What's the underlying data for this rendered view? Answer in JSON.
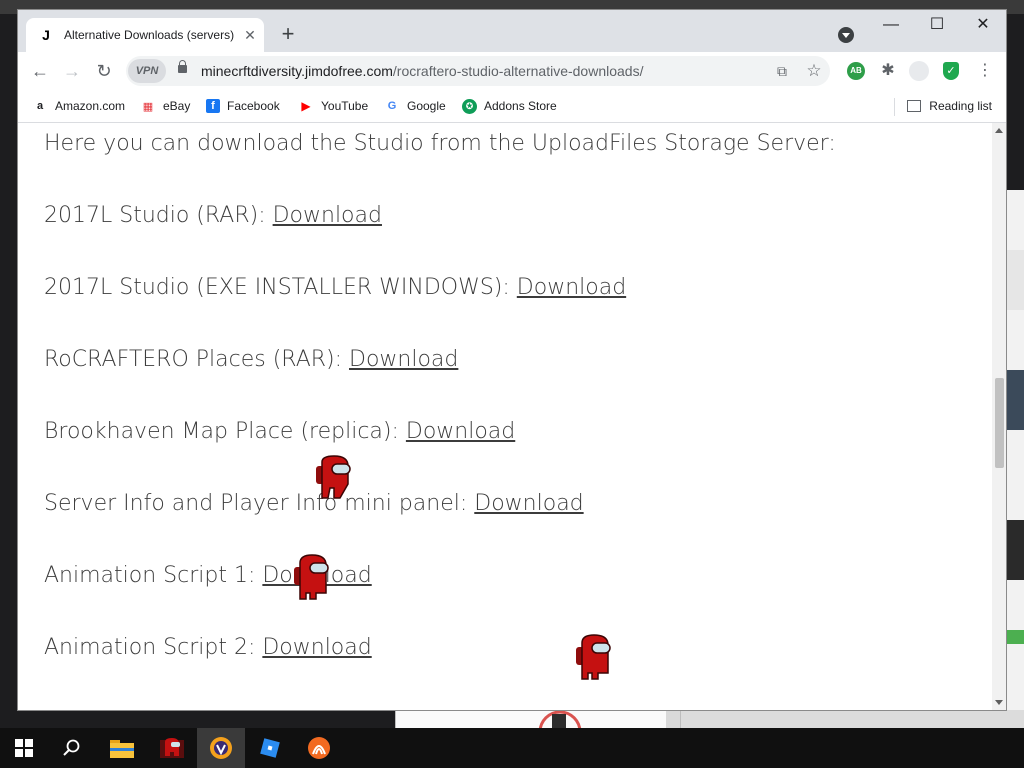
{
  "tab": {
    "favicon": "J",
    "title": "Alternative Downloads (servers)",
    "close": "✕"
  },
  "newtab": "+",
  "window_controls": {
    "minimize": "—",
    "maximize": "☐",
    "close": "✕"
  },
  "nav": {
    "back": "←",
    "forward": "→",
    "reload": "↻"
  },
  "omnibox": {
    "vpn": "VPN",
    "domain": "minecrftdiversity.jimdofree.com",
    "path": "/rocraftero-studio-alternative-downloads/"
  },
  "bookmarks": [
    {
      "label": "Amazon.com",
      "icon": "amazon-icon",
      "glyph": "a",
      "color": "#000000"
    },
    {
      "label": "eBay",
      "icon": "ebay-icon",
      "glyph": "▦",
      "color": "#e53238"
    },
    {
      "label": "Facebook",
      "icon": "facebook-icon",
      "glyph": "f",
      "color": "#1877f2"
    },
    {
      "label": "YouTube",
      "icon": "youtube-icon",
      "glyph": "▶",
      "color": "#ff0000"
    },
    {
      "label": "Google",
      "icon": "google-icon",
      "glyph": "G",
      "color": "#4285f4"
    },
    {
      "label": "Addons Store",
      "icon": "addons-store-icon",
      "glyph": "✪",
      "color": "#0f9d58"
    }
  ],
  "reading_list": "Reading list",
  "content": {
    "heading": "Here you can download the Studio from the UploadFiles Storage Server:",
    "items": [
      {
        "label": "2017L Studio (RAR): ",
        "link": "Download"
      },
      {
        "label": "2017L Studio (EXE INSTALLER WINDOWS): ",
        "link": "Download"
      },
      {
        "label": "RoCRAFTERO Places (RAR): ",
        "link": "Download"
      },
      {
        "label": "Brookhaven Map Place (replica): ",
        "link": "Download"
      },
      {
        "label": "Server Info and Player Info mini panel: ",
        "link": "Download"
      },
      {
        "label": "Animation Script 1: ",
        "link": "Download"
      },
      {
        "label": "Animation Script 2: ",
        "link": "Download"
      }
    ]
  },
  "colors": {
    "amongus": "#c51111",
    "visor": "#cfe3ea",
    "accent_green": "#1fa84f"
  }
}
